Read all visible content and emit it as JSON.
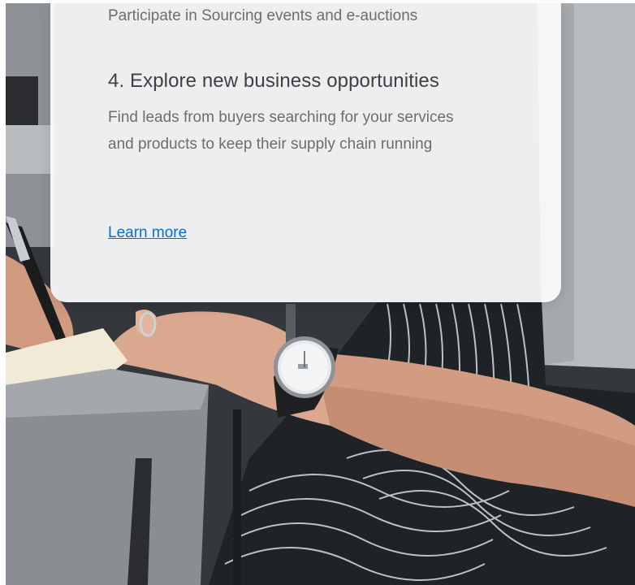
{
  "card": {
    "previous_item_text": "Participate in Sourcing events and e-auctions",
    "item_heading": "4. Explore new business opportunities",
    "item_description": "Find leads from buyers searching for your services and products to keep their supply chain running",
    "learn_more_label": "Learn more"
  },
  "colors": {
    "link": "#0a6ed1",
    "heading": "#3e4044",
    "body_text": "#6b6d70",
    "card_background": "#fcfcfd"
  },
  "background_image": {
    "subject": "person-writing-with-wristwatch-photo"
  }
}
